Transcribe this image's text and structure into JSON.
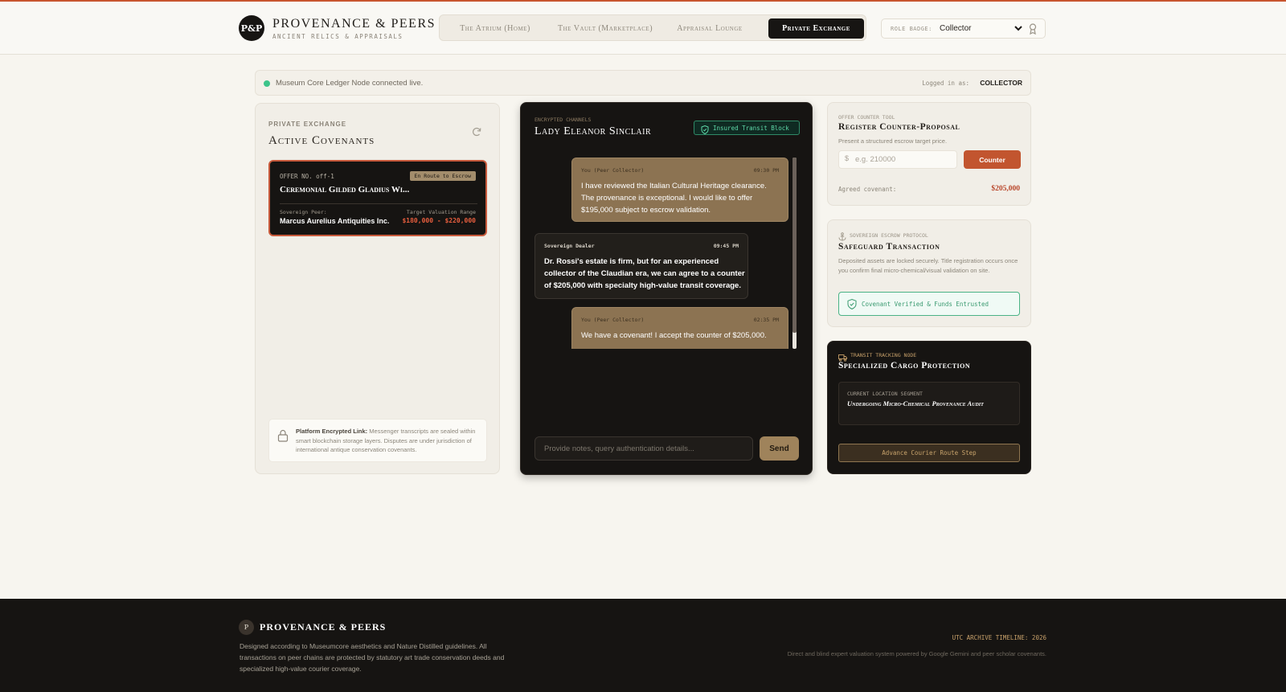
{
  "brand": {
    "badge": "P&P",
    "name": "PROVENANCE & PEERS",
    "tagline": "ANCIENT RELICS & APPRAISALS"
  },
  "nav": {
    "tabs": [
      {
        "label": "The Atrium (Home)",
        "active": false
      },
      {
        "label": "The Vault (Marketplace)",
        "active": false
      },
      {
        "label": "Appraisal Lounge",
        "active": false
      },
      {
        "label": "Private Exchange",
        "active": true
      }
    ]
  },
  "role": {
    "label": "ROLE BADGE:",
    "value": "Collector",
    "icon": "chevron-down-icon",
    "badge_icon": "award-icon"
  },
  "status": {
    "message": "Museum Core Ledger Node connected live.",
    "logged_label": "Logged in as:",
    "logged_role": "COLLECTOR",
    "dot_color": "#3cc48a"
  },
  "left": {
    "eyebrow": "PRIVATE EXCHANGE",
    "title": "Active Covenants",
    "refresh_icon": "refresh-icon",
    "offer": {
      "number": "OFFER NO. off-1",
      "status": "En Route to Escrow",
      "name": "Ceremonial Gilded Gladius Wi...",
      "peer_label": "Sovereign Peer:",
      "peer": "Marcus Aurelius Antiquities Inc.",
      "range_label": "Target Valuation Range",
      "range": "$180,000 - $220,000"
    },
    "notice": {
      "strong": "Platform Encrypted Link:",
      "text": " Messenger transcripts are sealed within smart blockchain storage layers. Disputes are under jurisdiction of international antique conservation covenants."
    }
  },
  "chat": {
    "eyebrow": "ENCRYPTED CHANNELS",
    "title": "Lady Eleanor Sinclair",
    "badge": "Insured Transit Block",
    "messages": [
      {
        "from": "You (Peer Collector)",
        "time": "09:30 PM",
        "lines": [
          "I have reviewed the Italian Cultural Heritage clearance.",
          "The provenance is exceptional. I would like to offer",
          "$195,000 subject to escrow validation."
        ]
      },
      {
        "from": "Sovereign Dealer",
        "time": "09:45 PM",
        "lines": [
          "Dr. Rossi's estate is firm, but for an experienced",
          "collector of the Claudian era, we can agree to a counter",
          "of $205,000 with specialty high-value transit coverage."
        ]
      },
      {
        "from": "You (Peer Collector)",
        "time": "02:35 PM",
        "lines": [
          "We have a covenant! I accept the counter of $205,000."
        ]
      }
    ],
    "input_placeholder": "Provide notes, query authentication details...",
    "send_label": "Send"
  },
  "counter": {
    "eyebrow": "OFFER COUNTER TOOL",
    "title": "Register Counter-Proposal",
    "subtitle": "Present a structured escrow target price.",
    "currency": "$",
    "placeholder": "e.g. 210000",
    "button": "Counter",
    "agreed_label": "Agreed covenant:",
    "agreed_value": "$205,000"
  },
  "escrow": {
    "eyebrow": "SOVEREIGN ESCROW PROTOCOL",
    "title": "Safeguard Transaction",
    "description": "Deposited assets are locked securely. Title registration occurs once you confirm final micro-chemical/visual validation on site.",
    "verified": "Covenant Verified & Funds Entrusted"
  },
  "transit": {
    "eyebrow": "TRANSIT TRACKING NODE",
    "title": "Specialized Cargo Protection",
    "location_label": "CURRENT LOCATION SEGMENT",
    "location_value": "Undergoing Micro-Chemical Provenance Audit",
    "button": "Advance Courier Route Step"
  },
  "footer": {
    "badge": "P",
    "brand": "PROVENANCE & PEERS",
    "description": "Designed according to Museumcore aesthetics and Nature Distilled guidelines. All transactions on peer chains are protected by statutory art trade conservation deeds and specialized high-value courier coverage.",
    "timeline": "UTC ARCHIVE TIMELINE: 2026",
    "credit": "Direct and blind expert valuation system powered by Google Gemini and peer scholar covenants."
  },
  "colors": {
    "accent": "#c2552f",
    "dark": "#161412",
    "gold": "#8c7352",
    "success": "#3cc48a"
  }
}
